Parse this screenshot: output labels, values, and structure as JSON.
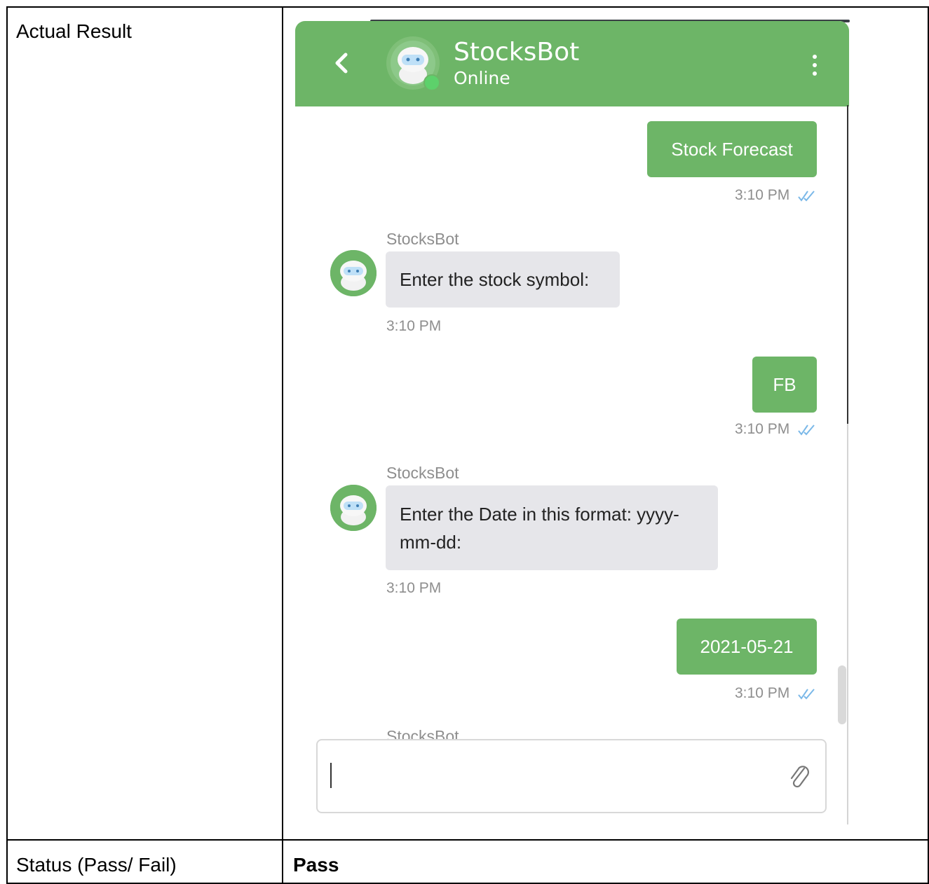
{
  "table": {
    "actual_result_label": "Actual Result",
    "status_label": "Status (Pass/ Fail)",
    "status_value": "Pass"
  },
  "chat": {
    "header": {
      "bot_name": "StocksBot",
      "status": "Online",
      "back_icon": "chevron-left-icon",
      "menu_icon": "vertical-dots-icon"
    },
    "messages": [
      {
        "from": "user",
        "text": "Stock Forecast",
        "time": "3:10 PM"
      },
      {
        "from": "bot",
        "sender": "StocksBot",
        "text": "Enter the stock symbol:",
        "time": "3:10 PM"
      },
      {
        "from": "user",
        "text": "FB",
        "time": "3:10 PM"
      },
      {
        "from": "bot",
        "sender": "StocksBot",
        "text": "Enter the Date in this format: yyyy-mm-dd:",
        "time": "3:10 PM"
      },
      {
        "from": "user",
        "text": "2021-05-21",
        "time": "3:10 PM"
      },
      {
        "from": "bot",
        "sender": "StocksBot"
      }
    ],
    "input": {
      "value": "",
      "attach_icon": "paperclip-icon"
    },
    "colors": {
      "accent": "#6db567",
      "bot_bubble": "#e6e6ea",
      "read_ticks": "#7ab8e8"
    }
  }
}
